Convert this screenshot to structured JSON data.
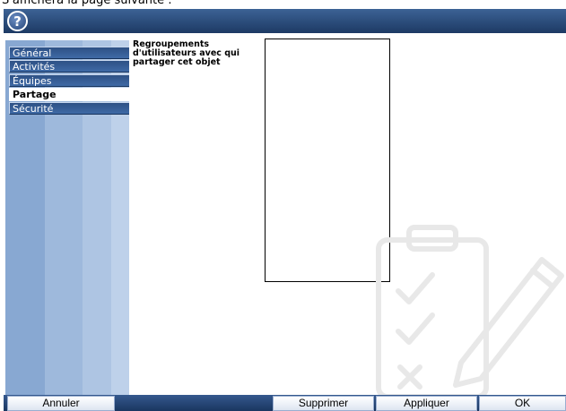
{
  "caption": "S'affichera la page suivante :",
  "titlebar": {
    "help_icon_glyph": "?"
  },
  "sidebar": {
    "items": [
      {
        "label": "Général",
        "active": false
      },
      {
        "label": "Activités",
        "active": false
      },
      {
        "label": "Équipes",
        "active": false
      },
      {
        "label": "Partage",
        "active": true
      },
      {
        "label": "Sécurité",
        "active": false
      }
    ]
  },
  "content": {
    "field_label": "Regroupements d'utilisateurs avec qui partager cet objet"
  },
  "footer": {
    "cancel_label": "Annuler",
    "delete_label": "Supprimer",
    "apply_label": "Appliquer",
    "ok_label": "OK"
  },
  "colors": {
    "titlebar": "#2a4a7a",
    "sidebar_tab": "#3a64a0",
    "sidebar_bg": "#9eb9dc"
  }
}
